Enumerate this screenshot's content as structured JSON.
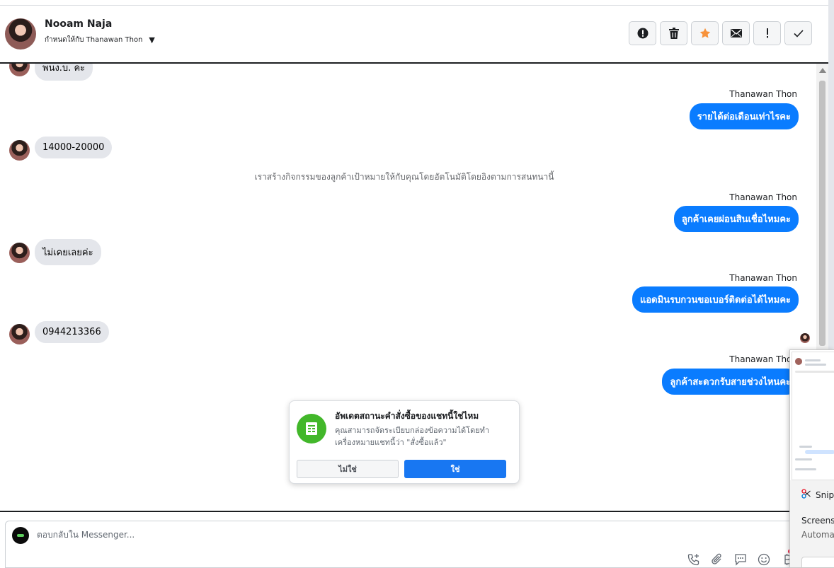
{
  "header": {
    "contact_name": "Nooam Naja",
    "assigned_label": "กำหนดให้กับ Thanawan Thon",
    "actions": [
      {
        "name": "spam-button",
        "icon": "alert-circle-icon"
      },
      {
        "name": "delete-button",
        "icon": "trash-icon"
      },
      {
        "name": "star-button",
        "icon": "star-icon"
      },
      {
        "name": "mark-unread-button",
        "icon": "mail-icon"
      },
      {
        "name": "follow-up-button",
        "icon": "exclamation-icon"
      },
      {
        "name": "mark-done-button",
        "icon": "check-icon"
      }
    ]
  },
  "conversation": {
    "partial_top_message": "พนง.บ. คะ",
    "items": [
      {
        "type": "outgoing",
        "sender": "Thanawan Thon",
        "text": "รายได้ต่อเดือนเท่าไรคะ"
      },
      {
        "type": "incoming",
        "text": "14000-20000"
      },
      {
        "type": "system",
        "text": "เราสร้างกิจกรรมของลูกค้าเป้าหมายให้กับคุณโดยอัตโนมัติโดยอิงตามการสนทนานี้"
      },
      {
        "type": "outgoing",
        "sender": "Thanawan Thon",
        "text": "ลูกค้าเคยผ่อนสินเชื่อไหมคะ"
      },
      {
        "type": "incoming",
        "text": "ไม่เคยเลยค่ะ"
      },
      {
        "type": "outgoing",
        "sender": "Thanawan Thon",
        "text": "แอดมินรบกวนขอเบอร์ติดต่อได้ไหมคะ"
      },
      {
        "type": "incoming",
        "text": "0944213366"
      },
      {
        "type": "outgoing",
        "sender": "Thanawan Thon",
        "text": "ลูกค้าสะดวกรับสายช่วงไหนคะ"
      }
    ]
  },
  "order_prompt": {
    "title": "อัพเดตสถานะคำสั่งซื้อของแชทนี้ใช่ไหม",
    "body": "คุณสามารถจัดระเบียบกล่องข้อความได้โดยทำเครื่องหมายแชทนี้ว่า \"สั่งซื้อแล้ว\"",
    "no_label": "ไม่ใช่",
    "yes_label": "ใช่"
  },
  "composer": {
    "placeholder": "ตอบกลับใน Messenger..."
  },
  "snip_overlay": {
    "app_name": "Snip",
    "title": "Screens",
    "subtitle": "Automa"
  },
  "colors": {
    "outgoing_bubble": "#0a7cff",
    "incoming_bubble": "#e4e6eb",
    "star": "#f7923b",
    "confirm_button": "#1877f2",
    "prompt_icon": "#42b72a"
  }
}
